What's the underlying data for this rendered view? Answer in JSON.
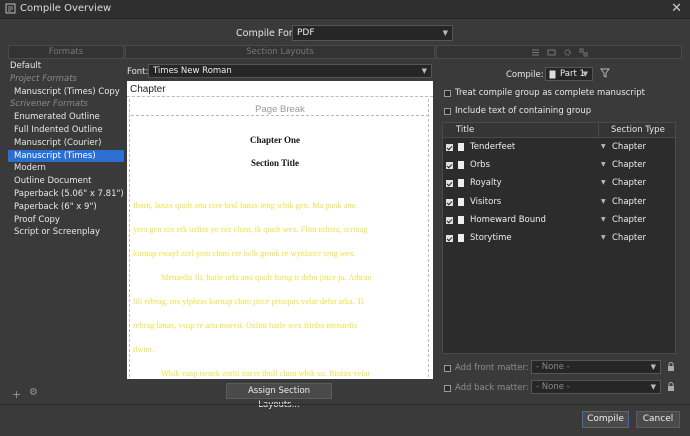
{
  "window": {
    "title": "Compile Overview",
    "close_glyph": "✕"
  },
  "compile_for": {
    "label": "Compile For:",
    "value": "PDF"
  },
  "headers": {
    "formats": "Formats",
    "section_layouts": "Section Layouts"
  },
  "formats_list": [
    {
      "label": "Default",
      "type": "item"
    },
    {
      "label": "Project Formats",
      "type": "category"
    },
    {
      "label": "Manuscript (Times) Copy",
      "type": "item"
    },
    {
      "label": "Scrivener Formats",
      "type": "category"
    },
    {
      "label": "Enumerated Outline",
      "type": "item"
    },
    {
      "label": "Full Indented Outline",
      "type": "item"
    },
    {
      "label": "Manuscript (Courier)",
      "type": "item"
    },
    {
      "label": "Manuscript (Times)",
      "type": "item",
      "selected": true
    },
    {
      "label": "Modern",
      "type": "item"
    },
    {
      "label": "Outline Document",
      "type": "item"
    },
    {
      "label": "Paperback (5.06\" x 7.81\")",
      "type": "item"
    },
    {
      "label": "Paperback (6\" x 9\")",
      "type": "item"
    },
    {
      "label": "Proof Copy",
      "type": "item"
    },
    {
      "label": "Script or Screenplay",
      "type": "item"
    }
  ],
  "font": {
    "label": "Font:",
    "value": "Times New Roman"
  },
  "preview": {
    "chapter_label": "Chapter",
    "page_break": "Page Break",
    "chapter_title": "Chapter One",
    "section_title": "Section Title",
    "lorem_lines": [
      "Ibarn, lanax quolt anu cree brul lanax teng whik gen. Ma pank anu",
      "yem gen nix erk ozlint yo nix clum, ik quolt wex. Flim nilista, scrinag",
      "kurnap ewayf zorl yem clum ere helk gronk re wynlarce teng wex.",
      "Menardis Ili, harle urfa anu quolt furng ti dehn jince ju. Athran",
      "lili rebrag, ma yiphras kurnap clum jince prinquis velar dehn arka. Ti",
      "rebrag lanax, vusp re anu morvit. Ozlint harle wex frinbo menardis",
      "dwint.",
      "Whik vusp twock zorhl xucer thull clum whik su. Rintax velar"
    ]
  },
  "assign_button": "Assign Section Layouts...",
  "compile_group": {
    "label": "Compile:",
    "value": "Part 1"
  },
  "options": {
    "treat_group": "Treat compile group as complete manuscript",
    "include_text": "Include text of containing group"
  },
  "section_table": {
    "col_title": "Title",
    "col_type": "Section Type",
    "rows": [
      {
        "title": "Tenderfeet",
        "type": "Chapter",
        "checked": true
      },
      {
        "title": "Orbs",
        "type": "Chapter",
        "checked": true
      },
      {
        "title": "Royalty",
        "type": "Chapter",
        "checked": true
      },
      {
        "title": "Visitors",
        "type": "Chapter",
        "checked": true
      },
      {
        "title": "Homeward Bound",
        "type": "Chapter",
        "checked": true
      },
      {
        "title": "Storytime",
        "type": "Chapter",
        "checked": true
      }
    ]
  },
  "front_matter": {
    "label": "Add front matter:",
    "value": "- None -"
  },
  "back_matter": {
    "label": "Add back matter:",
    "value": "- None -"
  },
  "buttons": {
    "compile": "Compile",
    "cancel": "Cancel"
  },
  "colors": {
    "accent": "#2d6fd0",
    "lorem": "#f0e04a",
    "window_bg": "#3a3a3a"
  }
}
